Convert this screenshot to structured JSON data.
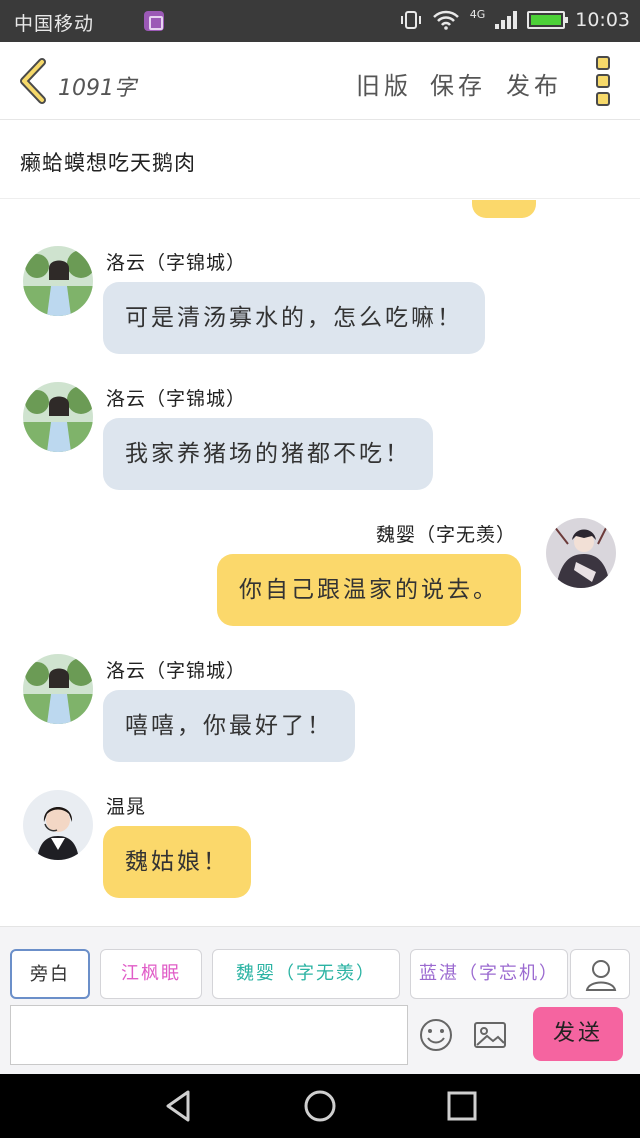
{
  "status_bar": {
    "carrier": "中国移动",
    "network": "4G",
    "time": "10:03",
    "battery_color": "#4cd137"
  },
  "header": {
    "word_count": "1091字",
    "old_version": "旧版",
    "save": "保存",
    "publish": "发布"
  },
  "story_title": "癞蛤蟆想吃天鹅肉",
  "messages": [
    {
      "side": "left",
      "name": "洛云（字锦城）",
      "text": "可是清汤寡水的，怎么吃嘛！",
      "avatar": "girl-field-avatar"
    },
    {
      "side": "left",
      "name": "洛云（字锦城）",
      "text": "我家养猪场的猪都不吃！",
      "avatar": "girl-field-avatar"
    },
    {
      "side": "right",
      "name": "魏婴（字无羡）",
      "text": "你自己跟温家的说去。",
      "avatar": "anime-man-avatar"
    },
    {
      "side": "left",
      "name": "洛云（字锦城）",
      "text": "嘻嘻，你最好了！",
      "avatar": "girl-field-avatar"
    },
    {
      "side": "left",
      "name": "温晁",
      "text": "魏姑娘！",
      "avatar": "woman-headset-avatar"
    }
  ],
  "characters": [
    {
      "label": "旁白",
      "color": "#333333"
    },
    {
      "label": "江枫眠",
      "color": "#e05cc7"
    },
    {
      "label": "魏婴（字无羡）",
      "color": "#2bb3a3"
    },
    {
      "label": "蓝湛（字忘机）",
      "color": "#9b6ad0"
    }
  ],
  "input": {
    "value": "",
    "placeholder": ""
  },
  "send_label": "发送",
  "colors": {
    "accent_yellow": "#fbd86b",
    "bubble_blue": "#dde5ee",
    "send_pink": "#f564a0"
  }
}
